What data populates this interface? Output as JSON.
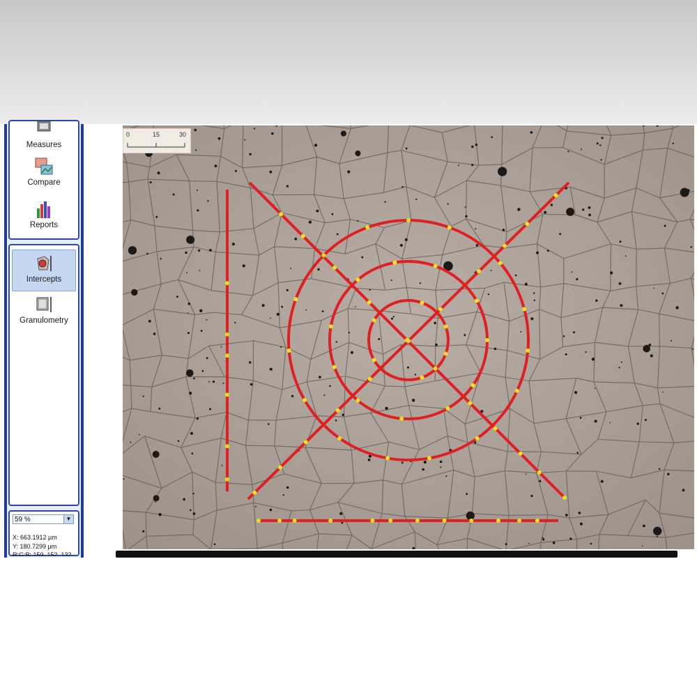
{
  "sidebar": {
    "tools": [
      {
        "label": "Measures",
        "icon": "measures-icon",
        "selected": false
      },
      {
        "label": "Compare",
        "icon": "compare-icon",
        "selected": false
      },
      {
        "label": "Reports",
        "icon": "reports-icon",
        "selected": false
      },
      {
        "label": "Intercepts",
        "icon": "intercepts-icon",
        "selected": true
      },
      {
        "label": "Granulometry",
        "icon": "granulometry-icon",
        "selected": false
      }
    ]
  },
  "status": {
    "zoom": "59 %",
    "x_coord": "X: 663.1912 µm",
    "y_coord": "Y: 180.7299 µm",
    "rgb_partial": "R:G:B: 159, 152, 132"
  },
  "scalebar": {
    "labels": [
      "0",
      "15",
      "30"
    ]
  },
  "colors": {
    "accent_blue": "#1e3c9a",
    "overlay_line": "#e02020",
    "intercept_point": "#f5e020",
    "micrograph_bg": "#ada29a"
  }
}
